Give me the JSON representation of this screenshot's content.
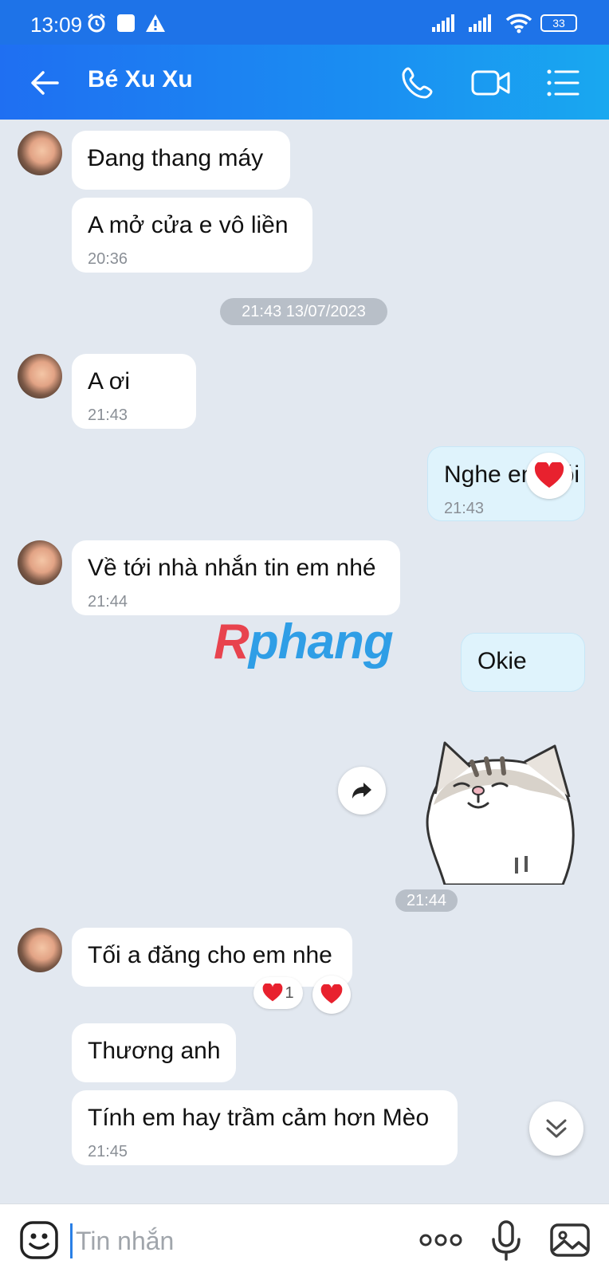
{
  "status_bar": {
    "time": "13:09",
    "battery": "33"
  },
  "header": {
    "title": "Bé Xu Xu"
  },
  "messages": [
    {
      "text": "Đang thang máy"
    },
    {
      "text": "A mở cửa e vô liền",
      "time": "20:36"
    },
    {
      "text": "A ơi",
      "time": "21:43"
    },
    {
      "text": "Nghe em nói",
      "time": "21:43"
    },
    {
      "text": "Về tới nhà nhắn tin em nhé",
      "time": "21:44"
    },
    {
      "text": "Okie"
    },
    {
      "text": "Tối a đăng cho em nhe"
    },
    {
      "text": "Thương anh"
    },
    {
      "text": "Tính em hay trầm cảm hơn Mèo",
      "time": "21:45"
    }
  ],
  "date_separator": "21:43 13/07/2023",
  "sticker_time": "21:44",
  "reaction_count": "1",
  "watermark": {
    "first": "R",
    "rest": "phang"
  },
  "input": {
    "placeholder": "Tin nhắn"
  },
  "colors": {
    "header": "#1a8ef2",
    "chat_bg": "#e2e8f0",
    "my_bubble": "#dff3fc",
    "heart": "#e8212e"
  }
}
